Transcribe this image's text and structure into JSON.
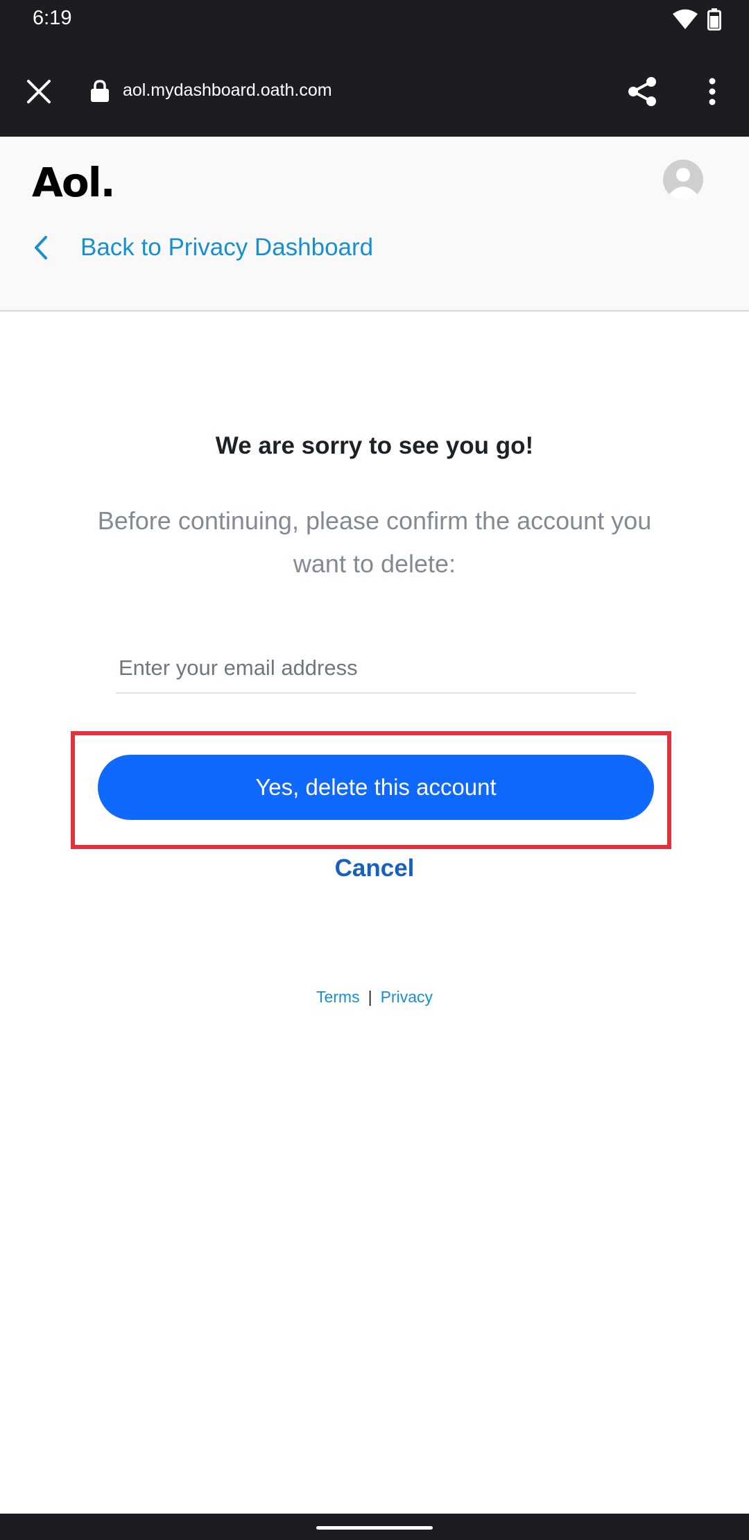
{
  "status_bar": {
    "time": "6:19"
  },
  "browser": {
    "url": "aol.mydashboard.oath.com",
    "icons": [
      "close-icon",
      "lock-icon",
      "share-icon",
      "more-vert-icon"
    ]
  },
  "header": {
    "logo_text": "Aol.",
    "back_label": "Back to Privacy Dashboard"
  },
  "main": {
    "heading": "We are sorry to see you go!",
    "description": "Before continuing, please confirm the account you want to delete:",
    "email_placeholder": "Enter your email address",
    "email_value": "",
    "delete_button_label": "Yes, delete this account",
    "cancel_label": "Cancel"
  },
  "footer": {
    "terms_label": "Terms",
    "separator": "|",
    "privacy_label": "Privacy"
  },
  "colors": {
    "brand_blue": "#0f69ff",
    "link_blue": "#188fcf",
    "highlight_red": "#e2323d"
  }
}
